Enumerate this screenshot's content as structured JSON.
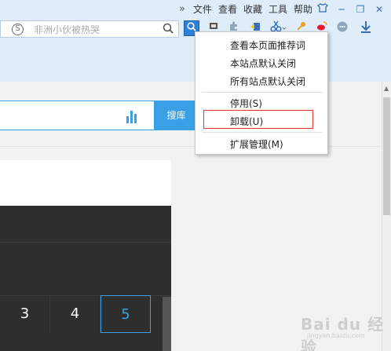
{
  "menubar": {
    "more": "»",
    "items": [
      "文件",
      "查看",
      "收藏",
      "工具",
      "帮助"
    ],
    "window_buttons": [
      "─",
      "❐",
      "✕"
    ]
  },
  "searchbar": {
    "engine_icon": "S",
    "value": "非洲小伙被热哭"
  },
  "page": {
    "search_button": "搜库",
    "numbers": [
      "3",
      "4",
      "5"
    ],
    "selected_number": "5"
  },
  "context_menu": {
    "items": [
      "查看本页面推荐词",
      "本站点默认关闭",
      "所有站点默认关闭",
      "停用(S)",
      "卸载(U)",
      "扩展管理(M)"
    ],
    "highlighted": "卸载(U)"
  },
  "watermark": {
    "brand": "Bai du 经验",
    "sub": "jingyan.baidu.com"
  },
  "colors": {
    "chrome_bg": "#deedf9",
    "accent": "#3aa0e6",
    "highlight_border": "#e53333",
    "dark_panel": "#2e2e2e"
  }
}
